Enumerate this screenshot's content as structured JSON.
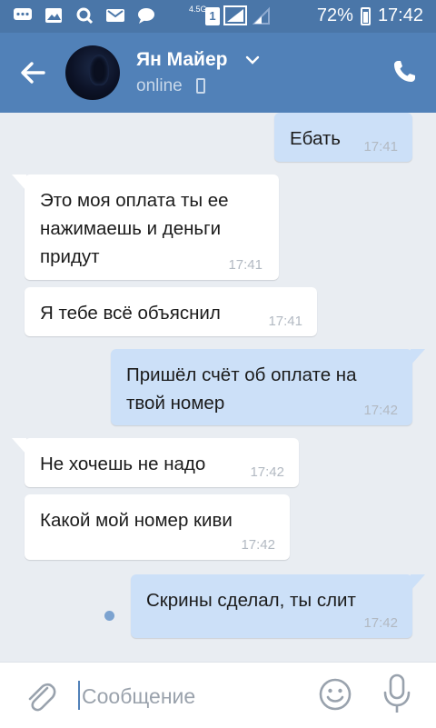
{
  "status_bar": {
    "network_type": "4.5G",
    "sim_slot": "1",
    "battery_percent": "72%",
    "time": "17:42",
    "notification_icons": [
      "chat-bubble-icon",
      "image-icon",
      "search-icon",
      "mail-icon",
      "message-icon"
    ]
  },
  "header": {
    "contact_name": "Ян Майер",
    "status": "online",
    "accent_color": "#5181b8"
  },
  "messages": [
    {
      "direction": "out",
      "text": "Ебать",
      "time": "17:41"
    },
    {
      "direction": "in",
      "text": "Это моя оплата ты ее нажимаешь и деньги придут",
      "time": "17:41"
    },
    {
      "direction": "in",
      "text": "Я тебе всё объяснил",
      "time": "17:41"
    },
    {
      "direction": "out",
      "text": "Пришёл счёт об оплате на твой номер",
      "time": "17:42"
    },
    {
      "direction": "in",
      "text": "Не хочешь не надо",
      "time": "17:42"
    },
    {
      "direction": "in",
      "text": "Какой мой номер киви",
      "time": "17:42"
    },
    {
      "direction": "out",
      "text": "Скрины сделал, ты слит",
      "time": "17:42"
    }
  ],
  "composer": {
    "placeholder": "Сообщение",
    "value": ""
  }
}
